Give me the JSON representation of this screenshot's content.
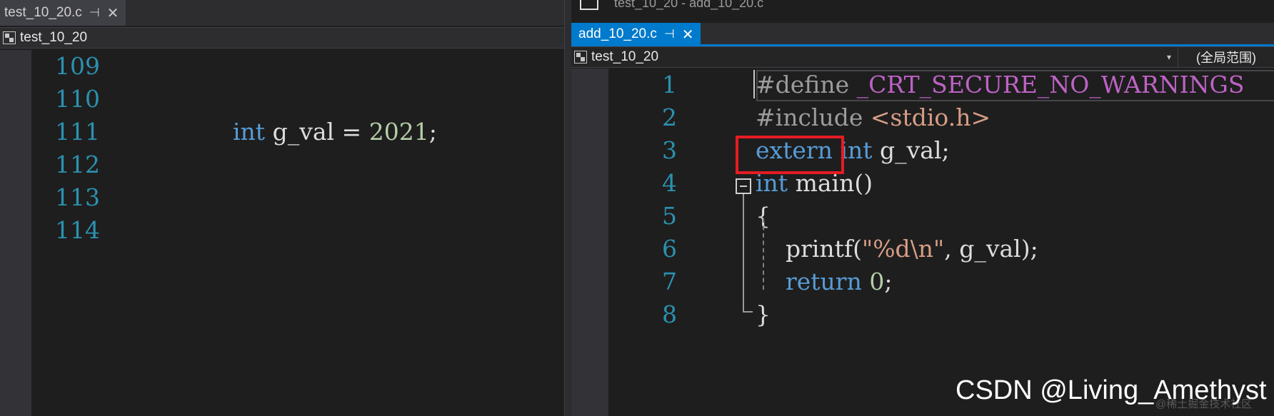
{
  "left_pane": {
    "tab": {
      "label": "test_10_20.c",
      "pin_glyph": "⊣",
      "close_glyph": "✕"
    },
    "nav": {
      "project": "test_10_20"
    },
    "lines": [
      {
        "num": "109",
        "code": []
      },
      {
        "num": "110",
        "code": []
      },
      {
        "num": "111",
        "code": [
          {
            "t": "int",
            "c": "kw"
          },
          {
            "t": " g_val = ",
            "c": "punct"
          },
          {
            "t": "2021",
            "c": "num"
          },
          {
            "t": ";",
            "c": "punct"
          }
        ]
      },
      {
        "num": "112",
        "code": []
      },
      {
        "num": "113",
        "code": []
      },
      {
        "num": "114",
        "code": []
      }
    ]
  },
  "right_pane": {
    "title": "test_10_20 - add_10_20.c",
    "tab": {
      "label": "add_10_20.c",
      "pin_glyph": "⊣",
      "close_glyph": "✕"
    },
    "nav": {
      "project": "test_10_20",
      "dropdown_glyph": "▾",
      "scope": "(全局范围)"
    },
    "lines": [
      {
        "num": "1",
        "code": [
          {
            "t": "#define ",
            "c": "pp"
          },
          {
            "t": "_CRT_SECURE_NO_WARNINGS",
            "c": "macro"
          }
        ]
      },
      {
        "num": "2",
        "code": [
          {
            "t": "#include ",
            "c": "pp"
          },
          {
            "t": "<stdio.h>",
            "c": "str"
          }
        ]
      },
      {
        "num": "3",
        "code": [
          {
            "t": "extern",
            "c": "kw"
          },
          {
            "t": " ",
            "c": "punct"
          },
          {
            "t": "int",
            "c": "kw"
          },
          {
            "t": " g_val;",
            "c": "punct"
          }
        ]
      },
      {
        "num": "4",
        "code": [
          {
            "t": "int",
            "c": "kw"
          },
          {
            "t": " main()",
            "c": "punct"
          }
        ]
      },
      {
        "num": "5",
        "code": [
          {
            "t": "{",
            "c": "punct"
          }
        ]
      },
      {
        "num": "6",
        "code": [
          {
            "t": "    printf(",
            "c": "punct"
          },
          {
            "t": "\"%d\\n\"",
            "c": "str"
          },
          {
            "t": ", g_val);",
            "c": "punct"
          }
        ]
      },
      {
        "num": "7",
        "code": [
          {
            "t": "    ",
            "c": "punct"
          },
          {
            "t": "return",
            "c": "kw"
          },
          {
            "t": " ",
            "c": "punct"
          },
          {
            "t": "0",
            "c": "num"
          },
          {
            "t": ";",
            "c": "punct"
          }
        ]
      },
      {
        "num": "8",
        "code": [
          {
            "t": "}",
            "c": "punct"
          }
        ]
      }
    ]
  },
  "watermark": "CSDN @Living_Amethyst",
  "watermark_faint": "@稀土掘金技术社区",
  "colors": {
    "accent": "#007acc",
    "highlight": "#e51c23",
    "line_number": "#2b91af",
    "keyword": "#569cd6"
  }
}
